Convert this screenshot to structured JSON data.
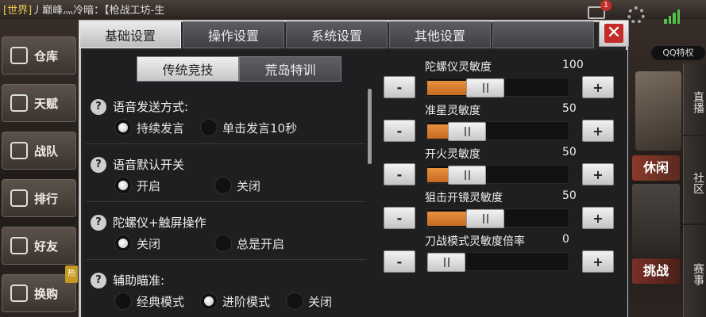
{
  "chat": {
    "channel": "[世界]",
    "text": "丿巅峰灬冷暗：【枪战工坊-生"
  },
  "mail": {
    "badge": "1"
  },
  "left_menu": [
    {
      "label": "仓库"
    },
    {
      "label": "天赋"
    },
    {
      "label": "战队"
    },
    {
      "label": "排行"
    },
    {
      "label": "好友"
    },
    {
      "label": "换购"
    }
  ],
  "hot_badge": "热",
  "right": {
    "qq_badge": "QQ特权",
    "leisure": "休闲",
    "challenge": "挑战",
    "tabs": [
      "直播",
      "社区",
      "赛事"
    ]
  },
  "dialog": {
    "tabs": [
      "基础设置",
      "操作设置",
      "系统设置",
      "其他设置",
      ""
    ],
    "active_tab": 0,
    "close": "✕",
    "subtabs": [
      "传统竞技",
      "荒岛特训"
    ],
    "active_subtab": 0
  },
  "settings": [
    {
      "title": "语音发送方式:",
      "options": [
        "持续发言",
        "单击发言10秒"
      ],
      "selected": 0
    },
    {
      "title": "语音默认开关",
      "options": [
        "开启",
        "关闭"
      ],
      "selected": 0
    },
    {
      "title": "陀螺仪+触屏操作",
      "options": [
        "关闭",
        "总是开启"
      ],
      "selected": 0
    },
    {
      "title": "辅助瞄准:",
      "options": [
        "经典模式",
        "进阶模式",
        "关闭"
      ],
      "selected": 1
    }
  ],
  "help_icon": "?",
  "sliders": [
    {
      "label": "陀螺仪灵敏度",
      "value": "100",
      "fraction": 0.37
    },
    {
      "label": "准星灵敏度",
      "value": "50",
      "fraction": 0.2
    },
    {
      "label": "开火灵敏度",
      "value": "50",
      "fraction": 0.2
    },
    {
      "label": "狙击开镜灵敏度",
      "value": "50",
      "fraction": 0.37
    },
    {
      "label": "刀战模式灵敏度倍率",
      "value": "0",
      "fraction": 0.0
    }
  ],
  "minus_label": "-",
  "plus_label": "+"
}
